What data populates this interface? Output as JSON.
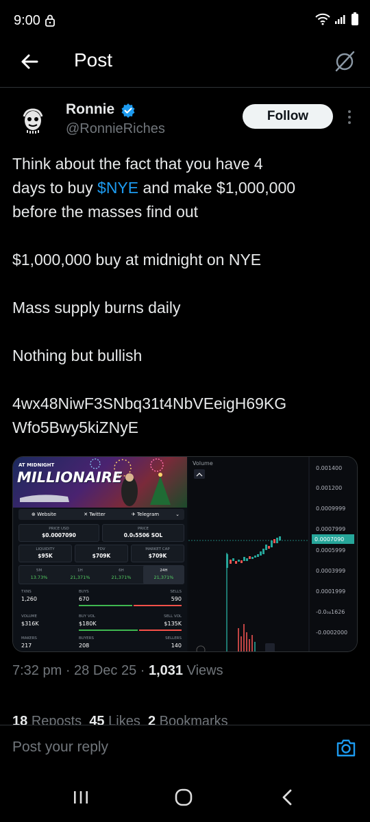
{
  "status_bar": {
    "time": "9:00",
    "icons": [
      "lock-icon",
      "wifi-icon",
      "signal-icon",
      "battery-icon"
    ]
  },
  "header": {
    "title": "Post"
  },
  "author": {
    "name": "Ronnie",
    "handle": "@RonnieRiches",
    "follow_label": "Follow",
    "verified_color": "#1d9bf0"
  },
  "tweet": {
    "line1_a": "Think about the fact that you have 4",
    "line2_a": "days to buy ",
    "cashtag": "$NYE",
    "line2_b": " and make $1,000,000",
    "line3": "before the masses find out",
    "para2": "$1,000,000 buy at midnight on NYE",
    "para3": "Mass supply burns daily",
    "para4": "Nothing but bullish",
    "address_line1": "4wx48NiwF3SNbq31t4NbVEeigH69KG",
    "address_line2": "Wfo5Bwy5kiZNyE"
  },
  "media_left": {
    "banner_small": "AT MIDNIGHT",
    "banner_big": "MILLIONAIRE",
    "links": [
      "⊕ Website",
      "✕ Twitter",
      "✈ Telegram",
      "⌄"
    ],
    "price_usd_label": "PRICE USD",
    "price_usd": "$0.0007090",
    "price_label": "PRICE",
    "price_sol": "0.0₅5506 SOL",
    "liquidity_label": "LIQUIDITY",
    "liquidity": "$95K",
    "fdv_label": "FDV",
    "fdv": "$709K",
    "mcap_label": "MARKET CAP",
    "mcap": "$709K",
    "timeframes": [
      {
        "label": "5M",
        "value": "13.73%"
      },
      {
        "label": "1H",
        "value": "21,371%"
      },
      {
        "label": "6H",
        "value": "21,371%"
      },
      {
        "label": "24H",
        "value": "21,371%"
      }
    ],
    "txns_label": "TXNS",
    "txns": "1,260",
    "buys_label": "BUYS",
    "buys": "670",
    "sells_label": "SELLS",
    "sells": "590",
    "volume_label": "VOLUME",
    "volume": "$316K",
    "buy_vol_label": "BUY VOL",
    "buy_vol": "$180K",
    "sell_vol_label": "SELL VOL",
    "sell_vol": "$135K",
    "makers_label": "MAKERS",
    "makers": "217",
    "buyers_label": "BUYERS",
    "buyers": "208",
    "sellers_label": "SELLERS",
    "sellers": "140"
  },
  "media_right": {
    "volume_label": "Volume",
    "price_ticks": [
      "0.001400",
      "0.001200",
      "0.0009999",
      "0.0007999",
      "0.0005999",
      "0.0003999",
      "0.0001999",
      "-0.0₀₄1626",
      "-0.0002000"
    ],
    "current_price": "0.0007090",
    "accent_green": "#26a69a",
    "accent_red": "#ef5350"
  },
  "meta": {
    "time": "7:32 pm",
    "date": "28 Dec 25",
    "views_count": "1,031",
    "views_label": "Views"
  },
  "engagement": {
    "reposts_count": "18",
    "reposts_label": "Reposts",
    "likes_count": "45",
    "likes_label": "Likes",
    "bookmarks_count": "2",
    "bookmarks_label": "Bookmarks"
  },
  "reply": {
    "placeholder": "Post your reply",
    "accent": "#1d9bf0"
  }
}
